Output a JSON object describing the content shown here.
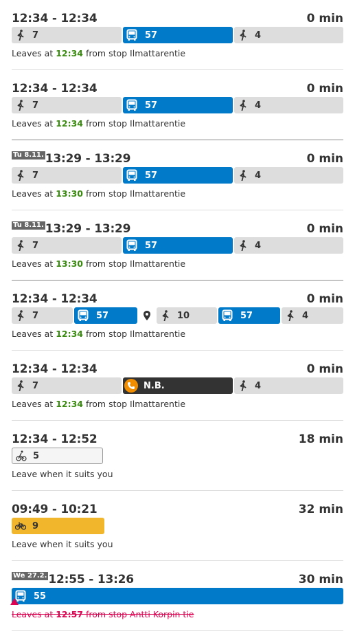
{
  "labels": {
    "leaves_at": "Leaves at",
    "from_stop": "from stop",
    "leave_when_suits": "Leave when it suits you"
  },
  "colors": {
    "walk": "#dddddd",
    "bus": "#007ac9",
    "call": "#333333",
    "citybike": "#f2b62d",
    "departure_time": "#3a8a0f",
    "cancelled": "#dc0451"
  },
  "itineraries": [
    {
      "day_badge": "",
      "time_range": "12:34 - 12:34",
      "duration": "0 min",
      "legs": [
        {
          "mode": "walk",
          "icon": "walk-icon",
          "label": "7"
        },
        {
          "mode": "bus",
          "icon": "bus-icon",
          "label": "57"
        },
        {
          "mode": "walk",
          "icon": "walk-icon",
          "label": "4"
        }
      ],
      "departure_time": "12:34",
      "stop_name": "Ilmattarentie"
    },
    {
      "day_badge": "",
      "time_range": "12:34 - 12:34",
      "duration": "0 min",
      "legs": [
        {
          "mode": "walk",
          "icon": "walk-icon",
          "label": "7"
        },
        {
          "mode": "bus",
          "icon": "bus-icon",
          "label": "57"
        },
        {
          "mode": "walk",
          "icon": "walk-icon",
          "label": "4"
        }
      ],
      "departure_time": "12:34",
      "stop_name": "Ilmattarentie"
    },
    {
      "day_badge": "Tu 8.11.",
      "time_range": "13:29 - 13:29",
      "duration": "0 min",
      "legs": [
        {
          "mode": "walk",
          "icon": "walk-icon",
          "label": "7"
        },
        {
          "mode": "bus",
          "icon": "bus-icon",
          "label": "57"
        },
        {
          "mode": "walk",
          "icon": "walk-icon",
          "label": "4"
        }
      ],
      "departure_time": "13:30",
      "stop_name": "Ilmattarentie"
    },
    {
      "day_badge": "Tu 8.11.",
      "time_range": "13:29 - 13:29",
      "duration": "0 min",
      "legs": [
        {
          "mode": "walk",
          "icon": "walk-icon",
          "label": "7"
        },
        {
          "mode": "bus",
          "icon": "bus-icon",
          "label": "57"
        },
        {
          "mode": "walk",
          "icon": "walk-icon",
          "label": "4"
        }
      ],
      "departure_time": "13:30",
      "stop_name": "Ilmattarentie"
    },
    {
      "day_badge": "",
      "time_range": "12:34 - 12:34",
      "duration": "0 min",
      "legs": [
        {
          "mode": "walk",
          "icon": "walk-icon",
          "label": "7"
        },
        {
          "mode": "bus",
          "icon": "bus-icon",
          "label": "57"
        },
        {
          "mode": "via",
          "icon": "location-pin-icon",
          "label": ""
        },
        {
          "mode": "walk",
          "icon": "walk-icon",
          "label": "10"
        },
        {
          "mode": "bus",
          "icon": "bus-icon",
          "label": "57"
        },
        {
          "mode": "walk",
          "icon": "walk-icon",
          "label": "4"
        }
      ],
      "departure_time": "12:34",
      "stop_name": "Ilmattarentie"
    },
    {
      "day_badge": "",
      "time_range": "12:34 - 12:34",
      "duration": "0 min",
      "legs": [
        {
          "mode": "walk",
          "icon": "walk-icon",
          "label": "7"
        },
        {
          "mode": "call",
          "icon": "phone-icon",
          "label": "N.B."
        },
        {
          "mode": "walk",
          "icon": "walk-icon",
          "label": "4"
        }
      ],
      "departure_time": "12:34",
      "stop_name": "Ilmattarentie"
    },
    {
      "day_badge": "",
      "time_range": "12:34 - 12:52",
      "duration": "18 min",
      "legs": [
        {
          "mode": "bike",
          "icon": "bicycle-icon",
          "label": "5"
        }
      ],
      "departure_time": "",
      "stop_name": ""
    },
    {
      "day_badge": "",
      "time_range": "09:49 - 10:21",
      "duration": "32 min",
      "legs": [
        {
          "mode": "citybike",
          "icon": "citybike-icon",
          "label": "9"
        }
      ],
      "departure_time": "",
      "stop_name": ""
    },
    {
      "day_badge": "We 27.2.",
      "time_range": "12:55 - 13:26",
      "duration": "30 min",
      "legs": [
        {
          "mode": "bus",
          "icon": "bus-icon",
          "label": "55"
        }
      ],
      "departure_time": "12:57",
      "stop_name": "Antti Korpin tie",
      "cancelled": true
    }
  ]
}
